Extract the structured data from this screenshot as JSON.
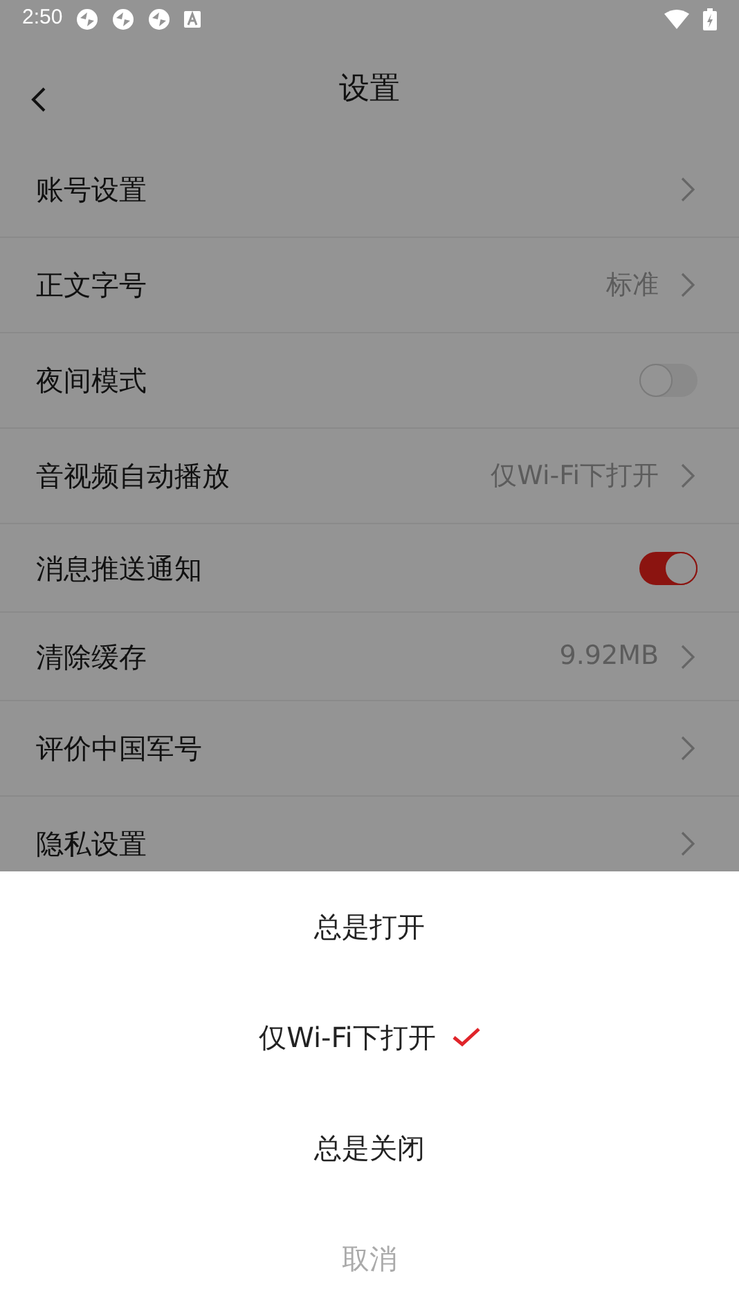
{
  "status_bar": {
    "time": "2:50"
  },
  "header": {
    "title": "设置"
  },
  "settings": [
    {
      "kind": "link",
      "label": "账号设置"
    },
    {
      "kind": "link",
      "label": "正文字号",
      "value": "标准"
    },
    {
      "kind": "toggle",
      "label": "夜间模式",
      "on": false
    },
    {
      "kind": "link",
      "label": "音视频自动播放",
      "value": "仅Wi-Fi下打开"
    },
    {
      "kind": "toggle",
      "label": "消息推送通知",
      "on": true
    },
    {
      "kind": "link",
      "label": "清除缓存",
      "value": "9.92MB"
    },
    {
      "kind": "link",
      "label": "评价中国军号"
    },
    {
      "kind": "link",
      "label": "隐私设置"
    }
  ],
  "sheet": {
    "options": [
      {
        "label": "总是打开",
        "selected": false
      },
      {
        "label": "仅Wi-Fi下打开",
        "selected": true
      },
      {
        "label": "总是关闭",
        "selected": false
      }
    ],
    "cancel": "取消"
  }
}
